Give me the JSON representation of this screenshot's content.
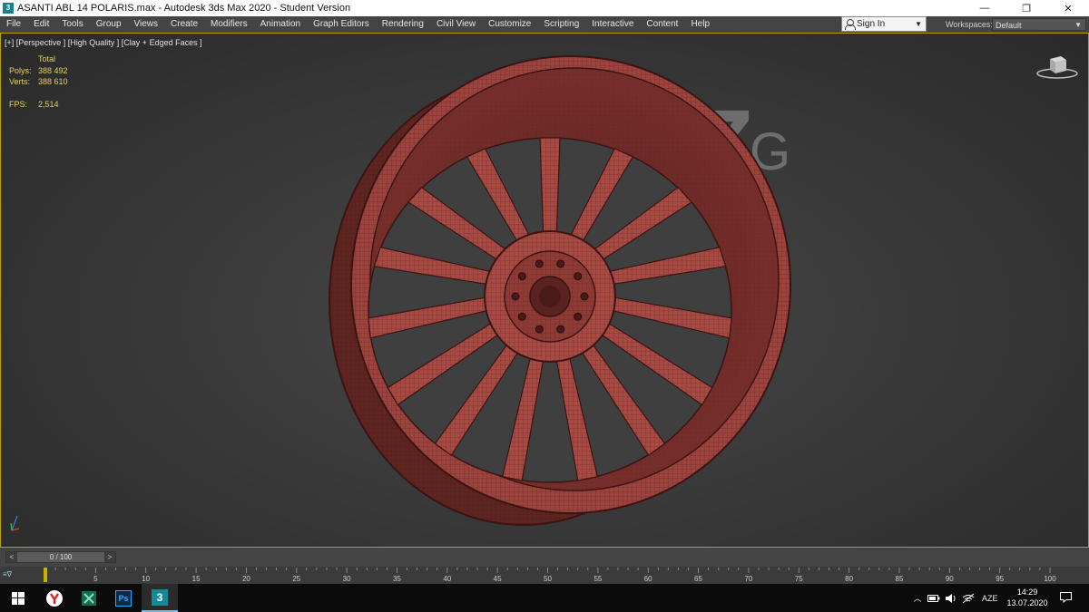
{
  "window": {
    "title": "ASANTI ABL 14 POLARIS.max - Autodesk 3ds Max 2020 - Student Version",
    "icon_label": "3",
    "minimize_glyph": "—",
    "maximize_glyph": "❐",
    "close_glyph": "✕"
  },
  "menu": {
    "items": [
      "File",
      "Edit",
      "Tools",
      "Group",
      "Views",
      "Create",
      "Modifiers",
      "Animation",
      "Graph Editors",
      "Rendering",
      "Civil View",
      "Customize",
      "Scripting",
      "Interactive",
      "Content",
      "Help"
    ],
    "sign_in": "Sign In",
    "workspaces_label": "Workspaces:",
    "workspace_value": "Default"
  },
  "viewport": {
    "label": "[+] [Perspective ] [High Quality ] [Clay + Edged Faces ]",
    "stats": {
      "total_label": "Total",
      "polys_label": "Polys:",
      "polys_value": "388 492",
      "verts_label": "Verts:",
      "verts_value": "388 610",
      "fps_label": "FPS:",
      "fps_value": "2,514"
    },
    "watermark": {
      "big": "Z",
      "small": "G"
    },
    "colors": {
      "wheel": "#a84a44",
      "wheel_dark": "#6e2b28",
      "wireframe": "#3a1412",
      "border": "#b5a200"
    }
  },
  "timeline": {
    "slider_value": "0 / 100",
    "prev": "<",
    "next": ">",
    "ticks": [
      "5",
      "10",
      "15",
      "20",
      "25",
      "30",
      "35",
      "40",
      "45",
      "50",
      "55",
      "60",
      "65",
      "70",
      "75",
      "80",
      "85",
      "90",
      "95",
      "100"
    ],
    "current_frame": 0,
    "total_frames": 100
  },
  "taskbar": {
    "apps": [
      "windows-start-icon",
      "yandex-browser-icon",
      "app-green-icon",
      "photoshop-icon",
      "3dsmax-icon"
    ],
    "ps_label": "Ps",
    "max_label": "3",
    "language": "AZE",
    "time": "14:29",
    "date": "13.07.2020"
  }
}
